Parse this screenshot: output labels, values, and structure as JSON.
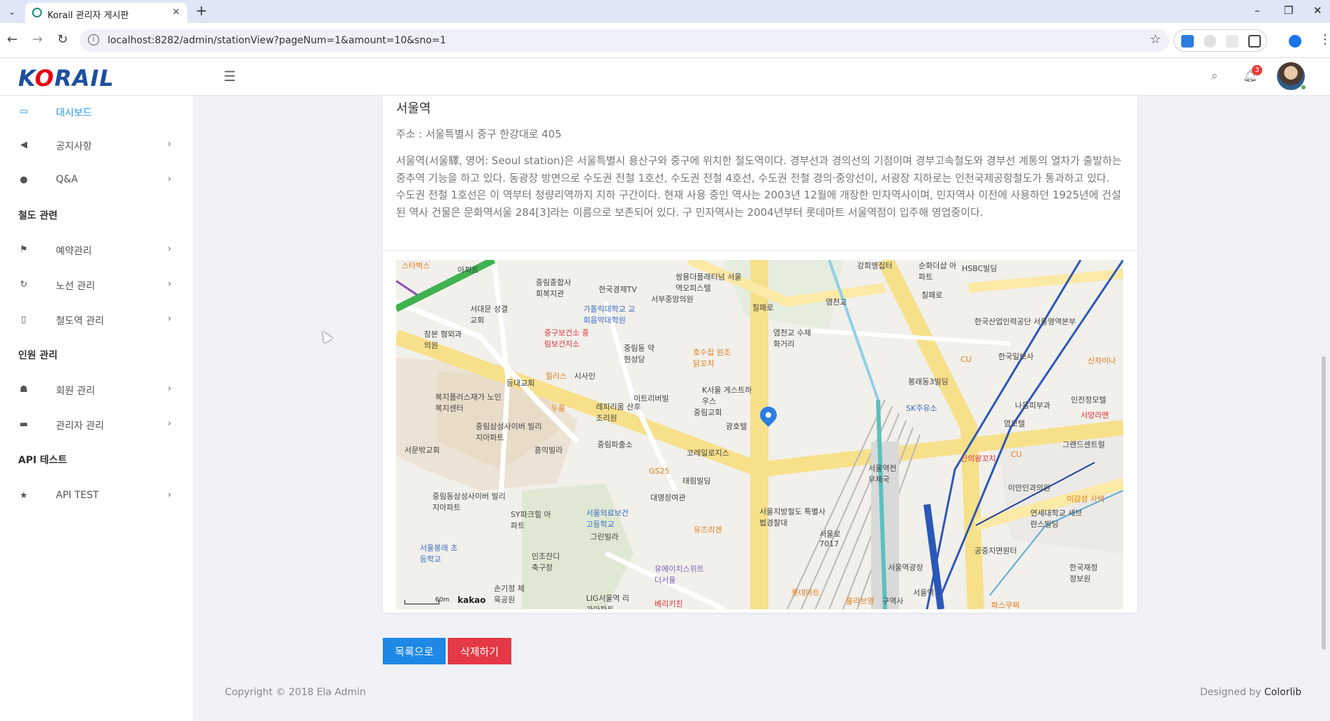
{
  "browser": {
    "tab_title": "Korail 관리자 게시판",
    "url": "localhost:8282/admin/stationView?pageNum=1&amount=10&sno=1",
    "new_tab": "+",
    "close_tab": "×",
    "minimize": "–",
    "maximize": "❐",
    "close_window": "✕"
  },
  "header": {
    "logo": "KORAIL",
    "notification_count": "3"
  },
  "sidebar": {
    "items": [
      {
        "label": "대시보드",
        "icon": "laptop-icon",
        "glyph": "▭"
      },
      {
        "label": "공지사항",
        "icon": "bullhorn-icon",
        "glyph": "◀"
      },
      {
        "label": "Q&A",
        "icon": "comments-icon",
        "glyph": "●"
      }
    ],
    "section_rail": "철도 관련",
    "rail_items": [
      {
        "label": "예약관리",
        "icon": "flag-icon",
        "glyph": "⚑"
      },
      {
        "label": "노선 관리",
        "icon": "refresh-icon",
        "glyph": "↻"
      },
      {
        "label": "철도역 관리",
        "icon": "building-icon",
        "glyph": "▯"
      }
    ],
    "section_staff": "인원 관리",
    "staff_items": [
      {
        "label": "회원 관리",
        "icon": "users-icon",
        "glyph": "☗"
      },
      {
        "label": "관리자 관리",
        "icon": "briefcase-icon",
        "glyph": "▬"
      }
    ],
    "section_api": "API 테스트",
    "api_items": [
      {
        "label": "API TEST",
        "icon": "star-icon",
        "glyph": "★"
      }
    ],
    "chevron": "›"
  },
  "station": {
    "name": "서울역",
    "address": "주소 : 서울특별시 중구 한강대로 405",
    "description": "서울역(서울驛, 영어: Seoul station)은 서울특별시 용산구와 중구에 위치한 철도역이다. 경부선과 경의선의 기점이며 경부고속철도와 경부선 계통의 열차가 출발하는 중추역 기능을 하고 있다. 동광장 방면으로 수도권 전철 1호선, 수도권 전철 4호선, 수도권 전철 경의·중앙선이, 서광장 지하로는 인천국제공항철도가 통과하고 있다. 수도권 전철 1호선은 이 역부터 청량리역까지 지하 구간이다. 현재 사용 중인 역사는 2003년 12월에 개장한 민자역사이며, 민자역사 이전에 사용하던 1925년에 건설된 역사 건물은 문화역서울 284[3]라는 이름으로 보존되어 있다. 구 민자역사는 2004년부터 롯데마트 서울역점이 입주해 영업중이다."
  },
  "map": {
    "provider": "kakao",
    "scale": "60m",
    "labels": [
      {
        "text": "스타벅스",
        "cls": "orange"
      },
      {
        "text": "아피트",
        "cls": ""
      },
      {
        "text": "중림종합사회복지관",
        "cls": ""
      },
      {
        "text": "한국경제TV",
        "cls": ""
      },
      {
        "text": "쌍용더플래티넘 서울역오피스텔",
        "cls": ""
      },
      {
        "text": "강희맹집터",
        "cls": ""
      },
      {
        "text": "순화더샵 아파트",
        "cls": ""
      },
      {
        "text": "HSBC빌딩",
        "cls": ""
      },
      {
        "text": "서대문 성결교회",
        "cls": ""
      },
      {
        "text": "가톨릭대학교 교회음악대학원",
        "cls": "blue"
      },
      {
        "text": "서부중앙의원",
        "cls": ""
      },
      {
        "text": "칠패로",
        "cls": ""
      },
      {
        "text": "염천교",
        "cls": ""
      },
      {
        "text": "칠패로",
        "cls": ""
      },
      {
        "text": "한국산업인력공단 서울영역본부",
        "cls": ""
      },
      {
        "text": "중구보건소 중림보건지소",
        "cls": "red"
      },
      {
        "text": "참본 형외과의원",
        "cls": ""
      },
      {
        "text": "중림동 약현성당",
        "cls": ""
      },
      {
        "text": "염천교 수제화거리",
        "cls": ""
      },
      {
        "text": "호수집 원조 닭꼬치",
        "cls": "orange"
      },
      {
        "text": "CU",
        "cls": "orange"
      },
      {
        "text": "한국일보사",
        "cls": ""
      },
      {
        "text": "신차이나",
        "cls": "orange"
      },
      {
        "text": "힐리스",
        "cls": "orange"
      },
      {
        "text": "시사인",
        "cls": ""
      },
      {
        "text": "등대교회",
        "cls": ""
      },
      {
        "text": "봉래동3빌딩",
        "cls": ""
      },
      {
        "text": "복지플러스재가 노인복지센터",
        "cls": ""
      },
      {
        "text": "이트리버빌",
        "cls": ""
      },
      {
        "text": "K서울 게스트하우스",
        "cls": ""
      },
      {
        "text": "나음피부과",
        "cls": ""
      },
      {
        "text": "인전정모텔",
        "cls": ""
      },
      {
        "text": "두룸",
        "cls": "orange"
      },
      {
        "text": "레피리움 산후조리원",
        "cls": ""
      },
      {
        "text": "중림교회",
        "cls": ""
      },
      {
        "text": "서양라멘",
        "cls": "red"
      },
      {
        "text": "SK주유소",
        "cls": "blue"
      },
      {
        "text": "염모텔",
        "cls": ""
      },
      {
        "text": "중림삼성사이버 빌리지아파트",
        "cls": ""
      },
      {
        "text": "광호텔",
        "cls": ""
      },
      {
        "text": "중림파출소",
        "cls": ""
      },
      {
        "text": "그랜드센트럴",
        "cls": ""
      },
      {
        "text": "서문밖교회",
        "cls": ""
      },
      {
        "text": "흥익빌라",
        "cls": ""
      },
      {
        "text": "코레일로지스",
        "cls": ""
      },
      {
        "text": "신의왕꼬치",
        "cls": "red"
      },
      {
        "text": "CU",
        "cls": "orange"
      },
      {
        "text": "GS25",
        "cls": "orange"
      },
      {
        "text": "태림빌딩",
        "cls": ""
      },
      {
        "text": "서울역전 우체국",
        "cls": ""
      },
      {
        "text": "이안인과의원",
        "cls": ""
      },
      {
        "text": "중림동삼성사이버 빌리지아파트",
        "cls": ""
      },
      {
        "text": "대영장여관",
        "cls": ""
      },
      {
        "text": "이감성 사택",
        "cls": "orange"
      },
      {
        "text": "SY파크힐 아파트",
        "cls": ""
      },
      {
        "text": "서울의료보건 고등학교",
        "cls": "blue"
      },
      {
        "text": "서울지방철도 특별사법경찰대",
        "cls": ""
      },
      {
        "text": "연세대학교 세브란스빌딩",
        "cls": ""
      },
      {
        "text": "유즈리겐",
        "cls": "orange"
      },
      {
        "text": "서울로 7017",
        "cls": ""
      },
      {
        "text": "그린빌라",
        "cls": ""
      },
      {
        "text": "공중지면원터",
        "cls": ""
      },
      {
        "text": "서울봉래 초등학교",
        "cls": "blue"
      },
      {
        "text": "인조잔디 축구장",
        "cls": ""
      },
      {
        "text": "유에이치스위트 더서울",
        "cls": "purple"
      },
      {
        "text": "서울역광장",
        "cls": ""
      },
      {
        "text": "한국재정 정보원",
        "cls": ""
      },
      {
        "text": "롯데마트",
        "cls": "orange"
      },
      {
        "text": "손기정 체육공원",
        "cls": ""
      },
      {
        "text": "LIG서울역 리가아파트",
        "cls": ""
      },
      {
        "text": "베리키친",
        "cls": "red"
      },
      {
        "text": "올리브영",
        "cls": "orange"
      },
      {
        "text": "구역사",
        "cls": ""
      },
      {
        "text": "파스쿠찌",
        "cls": "orange"
      },
      {
        "text": "서울역",
        "cls": ""
      }
    ]
  },
  "buttons": {
    "list": "목록으로",
    "delete": "삭제하기"
  },
  "footer": {
    "copyright": "Copyright © 2018 Ela Admin",
    "designed_prefix": "Designed by ",
    "designed_by": "Colorlib"
  }
}
